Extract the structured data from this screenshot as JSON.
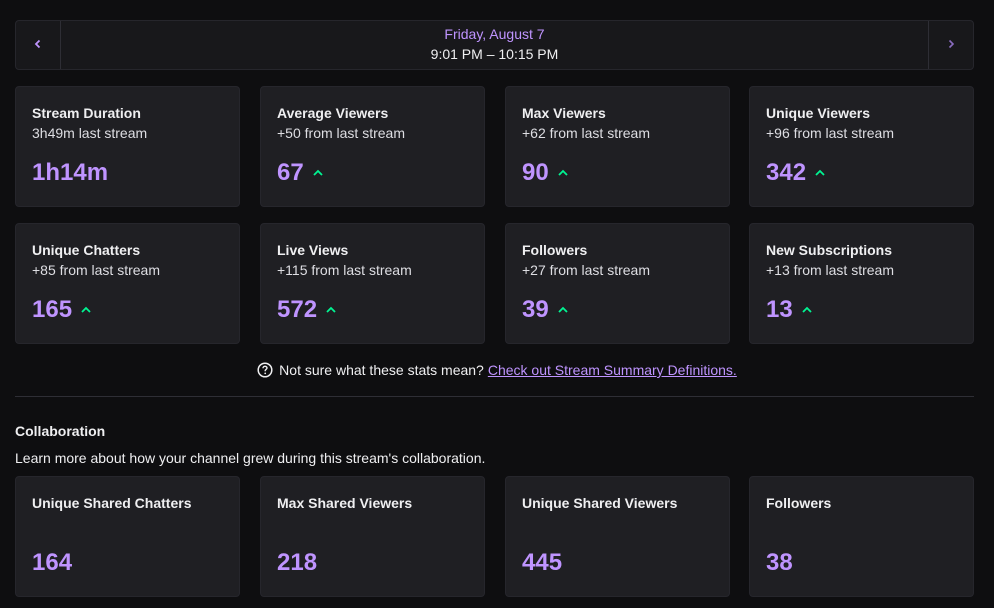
{
  "date_nav": {
    "prev_icon": "chevron-left-icon",
    "next_icon": "chevron-right-icon",
    "day": "Friday, August 7",
    "time_range": "9:01 PM – 10:15 PM"
  },
  "colors": {
    "accent": "#bf94ff",
    "positive": "#00f593",
    "card_bg": "#1f1f23",
    "page_bg": "#0e0e10"
  },
  "stats": [
    {
      "title": "Stream Duration",
      "subtitle": "3h49m last stream",
      "value": "1h14m",
      "trend": "none"
    },
    {
      "title": "Average Viewers",
      "subtitle": "+50 from last stream",
      "value": "67",
      "trend": "up"
    },
    {
      "title": "Max Viewers",
      "subtitle": "+62 from last stream",
      "value": "90",
      "trend": "up"
    },
    {
      "title": "Unique Viewers",
      "subtitle": "+96 from last stream",
      "value": "342",
      "trend": "up"
    },
    {
      "title": "Unique Chatters",
      "subtitle": "+85 from last stream",
      "value": "165",
      "trend": "up"
    },
    {
      "title": "Live Views",
      "subtitle": "+115 from last stream",
      "value": "572",
      "trend": "up"
    },
    {
      "title": "Followers",
      "subtitle": "+27 from last stream",
      "value": "39",
      "trend": "up"
    },
    {
      "title": "New Subscriptions",
      "subtitle": "+13 from last stream",
      "value": "13",
      "trend": "up"
    }
  ],
  "help": {
    "icon": "question-circle-icon",
    "text": "Not sure what these stats mean?",
    "link": "Check out Stream Summary Definitions."
  },
  "collaboration": {
    "title": "Collaboration",
    "description": "Learn more about how your channel grew during this stream's collaboration.",
    "stats": [
      {
        "title": "Unique Shared Chatters",
        "value": "164"
      },
      {
        "title": "Max Shared Viewers",
        "value": "218"
      },
      {
        "title": "Unique Shared Viewers",
        "value": "445"
      },
      {
        "title": "Followers",
        "value": "38"
      }
    ]
  }
}
